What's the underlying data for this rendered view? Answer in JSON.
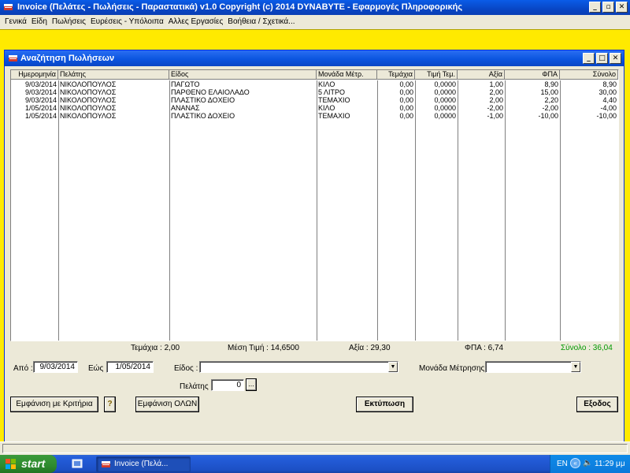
{
  "app": {
    "title": "Invoice (Πελάτες - Πωλήσεις - Παραστατικά)  v1.0  Copyright (c) 2014  DYNABYTE - Εφαρμογές Πληροφορικής"
  },
  "menu": [
    "Γενικά",
    "Είδη",
    "Πωλήσεις",
    "Ευρέσεις - Υπόλοιπα",
    "Αλλες Εργασίες",
    "Βοήθεια / Σχετικά..."
  ],
  "window": {
    "title": "Αναζήτηση Πωλήσεων"
  },
  "grid": {
    "columns": [
      "Ημερομηνία",
      "Πελάτης",
      "Είδος",
      "Μονάδα Μέτρ.",
      "Τεμάχια",
      "Τιμή Τεμ.",
      "Αξία",
      "ΦΠΑ",
      "Σύνολο"
    ],
    "rows": [
      [
        "9/03/2014",
        "ΝΙΚΟΛΟΠΟΥΛΟΣ",
        "ΠΑΓΩΤΟ",
        "ΚΙΛΟ",
        "0,00",
        "0,0000",
        "1,00",
        "8,90",
        "8,90"
      ],
      [
        "9/03/2014",
        "ΝΙΚΟΛΟΠΟΥΛΟΣ",
        "ΠΑΡΘΕΝΟ ΕΛΑΙΟΛΑΔΟ",
        "5 ΛΙΤΡΟ",
        "0,00",
        "0,0000",
        "2,00",
        "15,00",
        "30,00"
      ],
      [
        "9/03/2014",
        "ΝΙΚΟΛΟΠΟΥΛΟΣ",
        "ΠΛΑΣΤΙΚΟ ΔΟΧΕΙΟ",
        "ΤΕΜΑΧΙΟ",
        "0,00",
        "0,0000",
        "2,00",
        "2,20",
        "4,40"
      ],
      [
        "1/05/2014",
        "ΝΙΚΟΛΟΠΟΥΛΟΣ",
        "ΑΝΑΝΑΣ",
        "ΚΙΛΟ",
        "0,00",
        "0,0000",
        "-2,00",
        "-2,00",
        "-4,00"
      ],
      [
        "1/05/2014",
        "ΝΙΚΟΛΟΠΟΥΛΟΣ",
        "ΠΛΑΣΤΙΚΟ ΔΟΧΕΙΟ",
        "ΤΕΜΑΧΙΟ",
        "0,00",
        "0,0000",
        "-1,00",
        "-10,00",
        "-10,00"
      ]
    ]
  },
  "totals": {
    "pieces": "Τεμάχια : 2,00",
    "avg_price": "Μέση Τιμή : 14,6500",
    "value": "Αξία : 29,30",
    "vat": "ΦΠΑ : 6,74",
    "sum": "Σύνολο : 36,04"
  },
  "filters": {
    "from_label": "Από :",
    "from_value": "9/03/2014",
    "to_label": "Εώς :",
    "to_value": "1/05/2014",
    "item_label": "Είδος :",
    "item_value": "",
    "unit_label": "Μονάδα Μέτρησης :",
    "unit_value": "",
    "customer_label": "Πελάτης :",
    "customer_value": "0",
    "browse_label": "..."
  },
  "buttons": {
    "show_criteria": "Εμφάνιση με Κριτήρια",
    "help": "?",
    "show_all": "Εμφάνιση ΟΛΩΝ",
    "print": "Εκτύπωση",
    "exit": "Εξοδος"
  },
  "taskbar": {
    "start": "start",
    "task": "Invoice (Πελά...",
    "lang": "EN",
    "clock": "11:29 μμ"
  },
  "colors": {
    "mdi_background": "#ffea00",
    "sum_total": "#009900",
    "title_bar": "#0a5ce8"
  },
  "icons": [
    "app-icon",
    "help-icon",
    "start-flag-icon",
    "quick-launch-icon",
    "speaker-icon"
  ]
}
